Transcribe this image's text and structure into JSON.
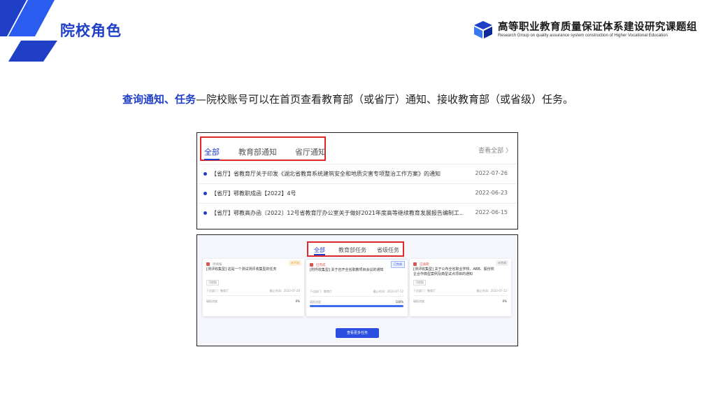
{
  "slide": {
    "title": "院校角色",
    "org_cn": "高等职业教育质量保证体系建设研究课题组",
    "org_en": "Research Group on quality assurance system construction of Higher Vocational Education",
    "intro_highlight": "查询通知、任务",
    "intro_rest": "—院校账号可以在首页查看教育部（或省厅）通知、接收教育部（或省级）任务。"
  },
  "notice_panel": {
    "tabs": [
      "全部",
      "教育部通知",
      "省厅通知"
    ],
    "view_all": "查看全部 〉",
    "items": [
      {
        "title": "【省厅】省教育厅关于印发《湖北省教育系统建筑安全和地质灾害专项整治工作方案》的通知",
        "date": "2022-07-26"
      },
      {
        "title": "【省厅】鄂教职成函【2022】4号",
        "date": "2022-06-23"
      },
      {
        "title": "【省厅】鄂教高办函〔2022〕12号省教育厅办公室关于做好2021年度高等继续教育发展报告编制工...",
        "date": "2022-06-15"
      }
    ]
  },
  "task_panel": {
    "tabs": [
      "全部",
      "教育部任务",
      "省级任务"
    ],
    "button": "查看更多任务",
    "cards": [
      {
        "status": "待填报",
        "badge": "未开始",
        "title": "[测评收集型] 这是一个测试测评收集型的任务",
        "tag": "可提报",
        "meta_left": "下达部门：教育厅",
        "meta_right": "截止时间：2022-07-26",
        "progress_label": "填报进度",
        "progress_pct": "0%",
        "progress": 0.0
      },
      {
        "status": "已完成",
        "badge": "已完成",
        "title": "[附件收集型] 关于召开全省职教项目会议的通知",
        "tag": "",
        "meta_left": "下达部门：教育厅",
        "meta_right": "截止时间：2022-07-12",
        "progress_label": "填报进度",
        "progress_pct": "100%",
        "progress": 1.0
      },
      {
        "status": "已逾期",
        "badge": "未完成",
        "title": "[测评收集型] 关于公布全省职业学校、ABB、股份校企合作典型案例及典型试点项目的通知",
        "tag": "可提报",
        "meta_left": "下达部门：教育厅",
        "meta_right": "截止时间：2022-07-12",
        "progress_label": "填报进度",
        "progress_pct": "0%",
        "progress": 0.0
      }
    ]
  },
  "colors": {
    "accent": "#1f3fc7",
    "highlight_box": "#e0272b",
    "button": "#2d4fe0"
  }
}
